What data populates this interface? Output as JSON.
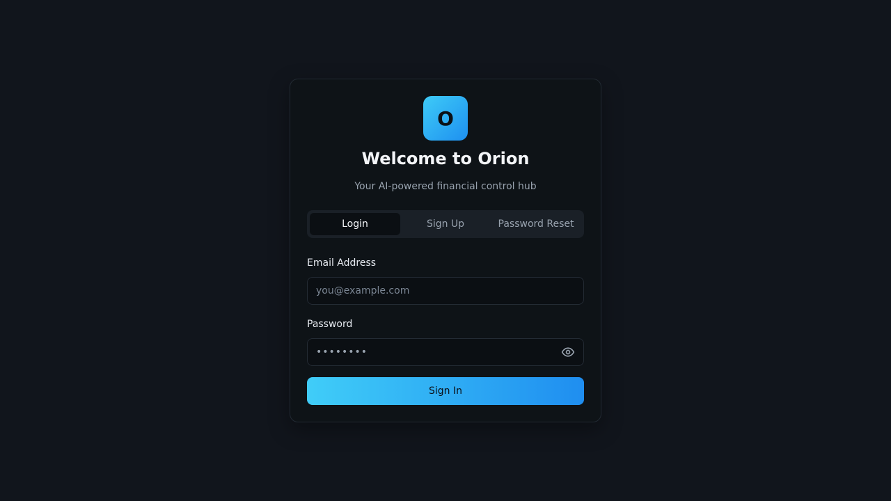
{
  "brand": {
    "logo_letter": "O",
    "title": "Welcome to Orion",
    "subtitle": "Your AI-powered financial control hub",
    "accent_start": "#3ecbf7",
    "accent_end": "#1e90f0"
  },
  "tabs": [
    {
      "label": "Login",
      "active": true
    },
    {
      "label": "Sign Up",
      "active": false
    },
    {
      "label": "Password Reset",
      "active": false
    }
  ],
  "form": {
    "email": {
      "label": "Email Address",
      "placeholder": "you@example.com",
      "value": ""
    },
    "password": {
      "label": "Password",
      "value": "••••••••",
      "toggle_icon": "eye-icon"
    },
    "submit_label": "Sign In"
  }
}
